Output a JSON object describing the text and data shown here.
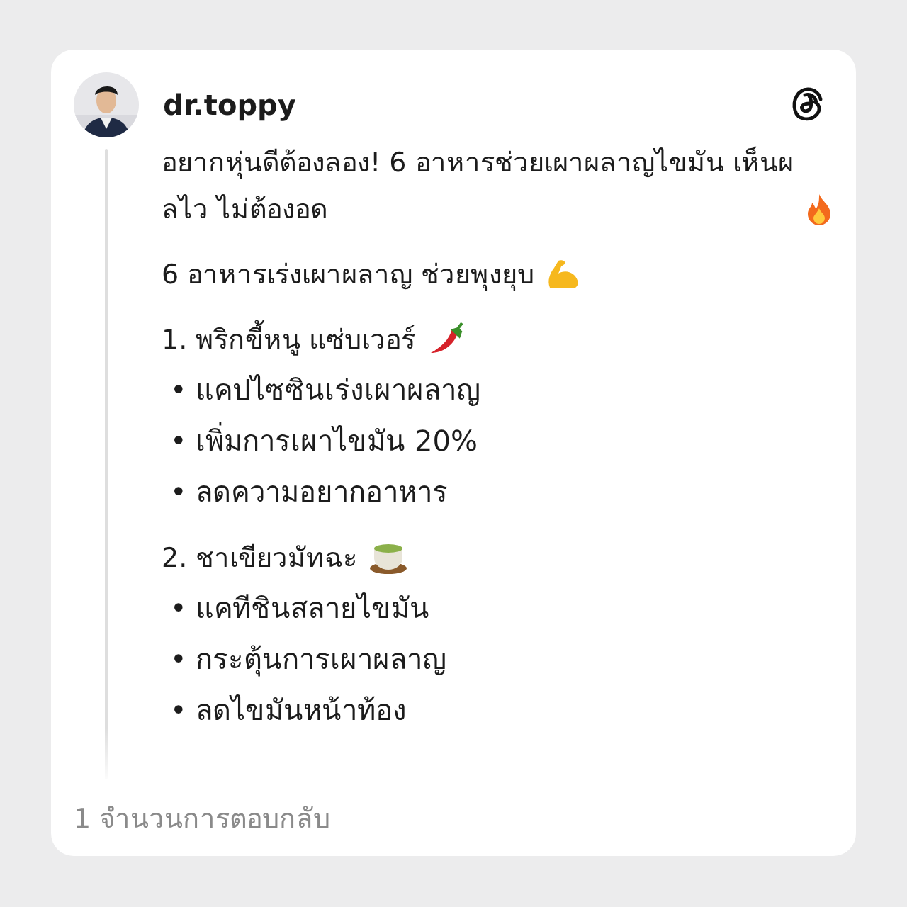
{
  "post": {
    "author": "dr.toppy",
    "paragraphs": [
      {
        "text": "อยากหุ่นดีต้องลอง! 6 อาหารช่วยเผาผลาญไขมัน เห็นผลไว ไม่ต้องอด",
        "kind": "fire"
      },
      {
        "text": "6 อาหารเร่งเผาผลาญ ช่วยพุงยุบ",
        "kind": "muscle"
      }
    ],
    "sections": [
      {
        "heading": "1. พริกขี้หนู แซ่บเวอร์",
        "kind": "pepper",
        "bullets": [
          "• แคปไซซินเร่งเผาผลาญ",
          "• เพิ่มการเผาไขมัน 20%",
          "• ลดความอยากอาหาร"
        ]
      },
      {
        "heading": "2. ชาเขียวมัทฉะ",
        "kind": "tea",
        "bullets": [
          "• แคทีชินสลายไขมัน",
          "• กระตุ้นการเผาผลาญ",
          "• ลดไขมันหน้าท้อง"
        ]
      }
    ],
    "replies": "1 จำนวนการตอบกลับ"
  }
}
